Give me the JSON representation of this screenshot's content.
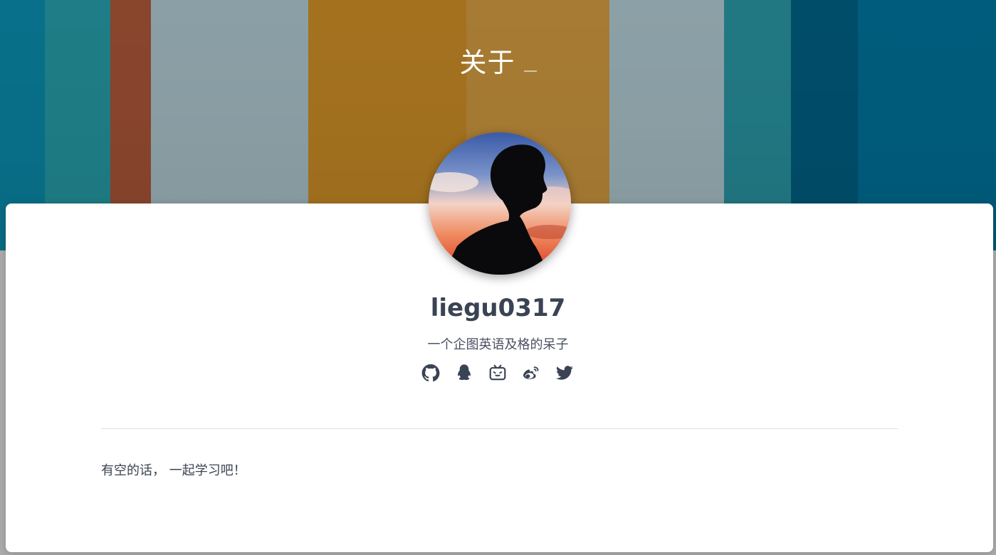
{
  "banner": {
    "title": "关于",
    "stripe_colors": [
      "#08708a",
      "#1e7d86",
      "#8a452d",
      "#8ba0a6",
      "#a4721f",
      "#a77b33",
      "#8ca1a7",
      "#217883",
      "#004d6a",
      "#005c7c"
    ]
  },
  "profile": {
    "username": "liegu0317",
    "bio": "一个企图英语及格的呆子"
  },
  "socials": [
    {
      "name": "github",
      "icon": "github-icon"
    },
    {
      "name": "qq",
      "icon": "qq-penguin-icon"
    },
    {
      "name": "bilibili",
      "icon": "bilibili-icon"
    },
    {
      "name": "weibo",
      "icon": "weibo-icon"
    },
    {
      "name": "twitter",
      "icon": "twitter-bird-icon"
    }
  ],
  "content": {
    "message": "有空的话， 一起学习吧！"
  },
  "colors": {
    "text_dark": "#3a4354",
    "icon": "#3a4354",
    "card_background": "#ffffff",
    "divider": "#dcdfe4"
  }
}
